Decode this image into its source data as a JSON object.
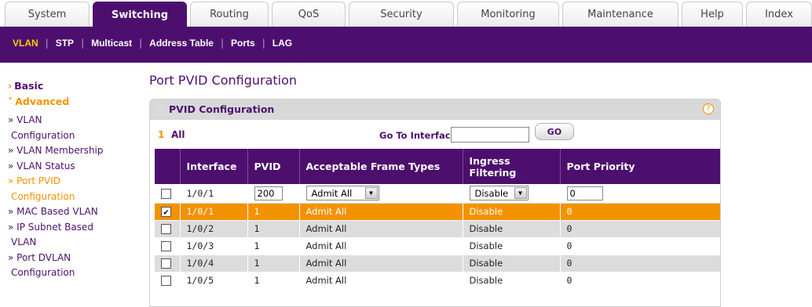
{
  "top_tabs": [
    "System",
    "Switching",
    "Routing",
    "QoS",
    "Security",
    "Monitoring",
    "Maintenance",
    "Help",
    "Index"
  ],
  "active_top_tab": "Switching",
  "sub_nav": [
    "VLAN",
    "STP",
    "Multicast",
    "Address Table",
    "Ports",
    "LAG"
  ],
  "active_sub_nav": "VLAN",
  "sidebar": {
    "basic": "Basic",
    "advanced": "Advanced",
    "links": [
      {
        "lines": [
          "» VLAN",
          "Configuration"
        ]
      },
      {
        "lines": [
          "» VLAN Membership"
        ]
      },
      {
        "lines": [
          "» VLAN Status"
        ]
      },
      {
        "lines": [
          "» Port PVID",
          "Configuration"
        ],
        "active": true
      },
      {
        "lines": [
          "» MAC Based VLAN"
        ]
      },
      {
        "lines": [
          "» IP Subnet Based",
          "VLAN"
        ]
      },
      {
        "lines": [
          "» Port DVLAN",
          "Configuration"
        ]
      }
    ]
  },
  "page_title": "Port PVID Configuration",
  "panel": {
    "title": "PVID Configuration",
    "help_glyph": "?",
    "goto_number": "1",
    "goto_all": "All",
    "goto_label": "Go To Interface",
    "goto_value": "",
    "go_button": "GO"
  },
  "table": {
    "headers": [
      "Interface",
      "PVID",
      "Acceptable Frame Types",
      "Ingress Filtering",
      "Port Priority"
    ],
    "input_row": {
      "interface": "1/0/1",
      "pvid": "200",
      "frame_types": "Admit All",
      "ingress": "Disable",
      "priority": "0"
    },
    "rows": [
      {
        "checked": true,
        "interface": "1/0/1",
        "pvid": "1",
        "frame_types": "Admit All",
        "ingress": "Disable",
        "priority": "0"
      },
      {
        "checked": false,
        "interface": "1/0/2",
        "pvid": "1",
        "frame_types": "Admit All",
        "ingress": "Disable",
        "priority": "0"
      },
      {
        "checked": false,
        "interface": "1/0/3",
        "pvid": "1",
        "frame_types": "Admit All",
        "ingress": "Disable",
        "priority": "0"
      },
      {
        "checked": false,
        "interface": "1/0/4",
        "pvid": "1",
        "frame_types": "Admit All",
        "ingress": "Disable",
        "priority": "0"
      },
      {
        "checked": false,
        "interface": "1/0/5",
        "pvid": "1",
        "frame_types": "Admit All",
        "ingress": "Disable",
        "priority": "0"
      }
    ]
  },
  "colors": {
    "brand_purple": "#4d0f6e",
    "accent_orange": "#f39200",
    "row_grey": "#dcdcdc"
  }
}
